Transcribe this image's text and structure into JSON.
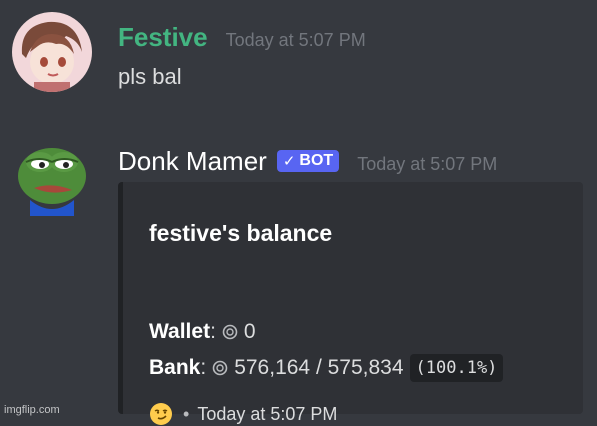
{
  "messages": [
    {
      "username": "Festive",
      "timestamp": "Today at 5:07 PM",
      "content": "pls bal",
      "username_color": "#43b581"
    },
    {
      "username": "Donk Mamer",
      "bot_tag": "BOT",
      "timestamp": "Today at 5:07 PM",
      "embed": {
        "title": "festive's balance",
        "wallet_label": "Wallet",
        "wallet_value": "0",
        "bank_label": "Bank",
        "bank_value": "576,164 / 575,834",
        "bank_percent": "(100.1%)",
        "footer_emoji_icon": "smirk-emoji-icon",
        "footer_time": "Today at 5:07 PM"
      }
    }
  ],
  "watermark": "imgflip.com",
  "colors": {
    "background": "#36393f",
    "embed_background": "#2f3136",
    "bot_tag": "#5865f2",
    "festive_name": "#43b581"
  }
}
